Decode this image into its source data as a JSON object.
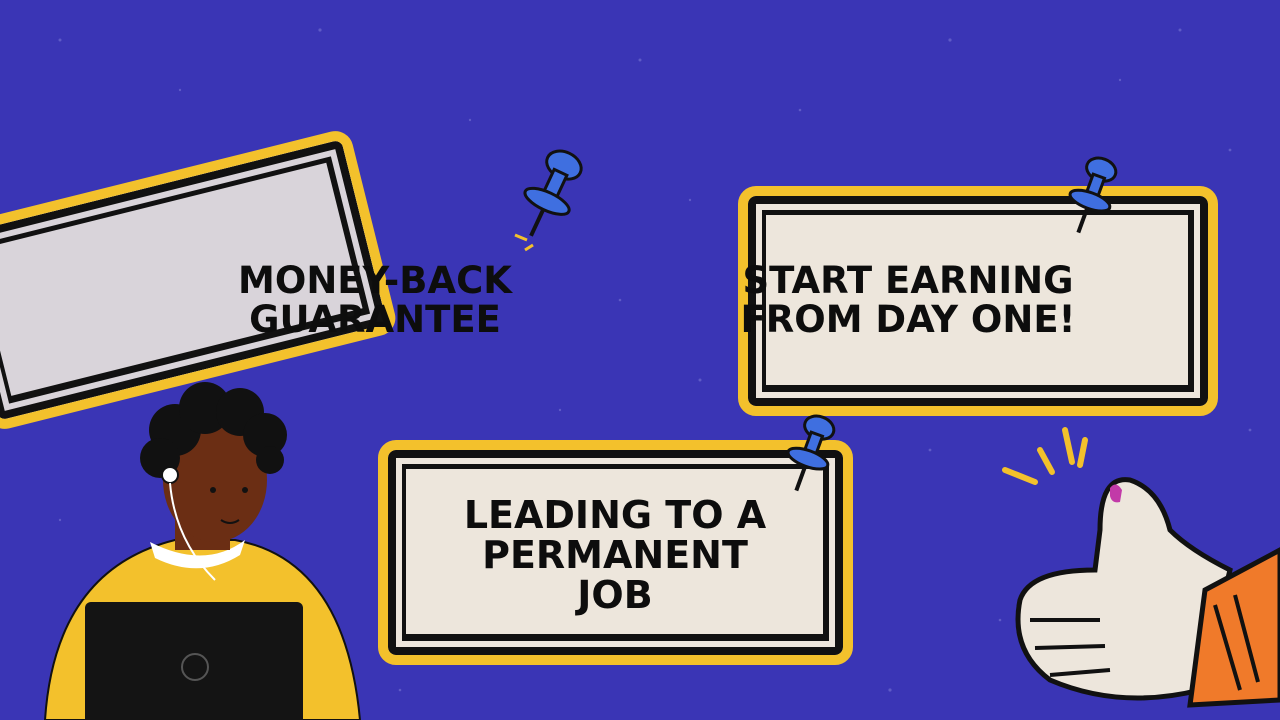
{
  "cards": {
    "money_back": "MONEY-BACK GUARANTEE",
    "start_earning": "START EARNING FROM DAY ONE!",
    "permanent_job": "LEADING TO A PERMANENT JOB"
  },
  "colors": {
    "background": "#3a35b5",
    "card_fill": "#ede6dc",
    "card_frame": "#f3c12c",
    "pin": "#3f6fe0",
    "shirt": "#f3c12c",
    "skin": "#6b2e14",
    "sleeve": "#f07a2a"
  },
  "icons": [
    "pushpin-icon",
    "thumbs-up-icon",
    "person-with-laptop-illustration"
  ]
}
